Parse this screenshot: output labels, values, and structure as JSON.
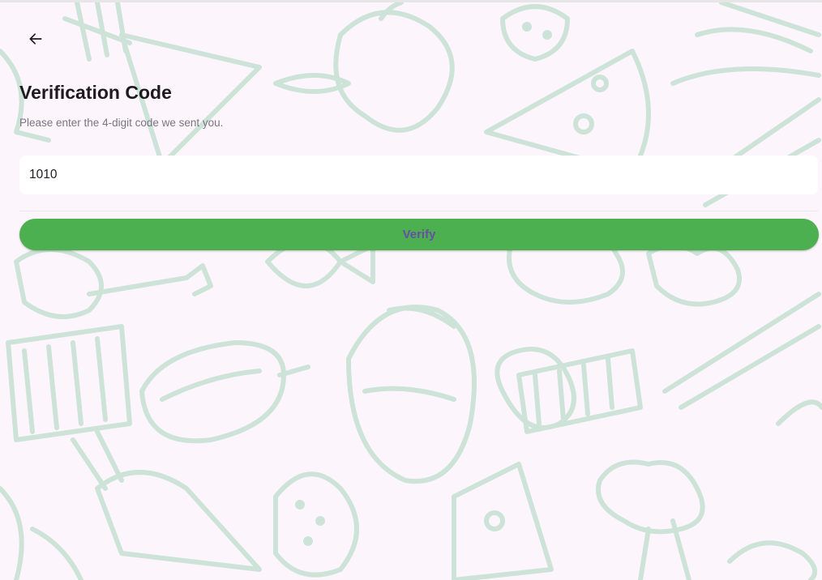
{
  "header": {
    "back_icon": "arrow-left-icon",
    "title": "Verification Code",
    "subtitle": "Please enter the 4-digit code we sent you."
  },
  "form": {
    "code_value": "1010",
    "submit_label": "Verify"
  },
  "theme": {
    "background": "#fcf6fc",
    "pattern_color": "#cde3d8",
    "button_color": "#4caf50",
    "button_text_color": "#6750a4"
  }
}
